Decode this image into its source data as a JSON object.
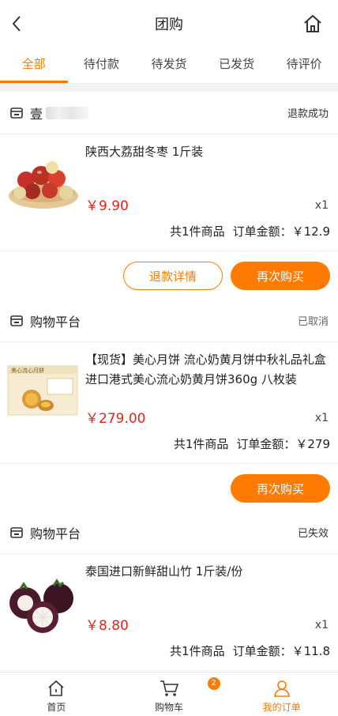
{
  "header": {
    "title": "团购",
    "back_icon": "chevron-left-icon",
    "home_icon": "home-icon"
  },
  "tabs": [
    {
      "label": "全部",
      "active": true
    },
    {
      "label": "待付款",
      "active": false
    },
    {
      "label": "待发货",
      "active": false
    },
    {
      "label": "已发货",
      "active": false
    },
    {
      "label": "待评价",
      "active": false
    }
  ],
  "orders": [
    {
      "shop_name": "壹",
      "status": "退款成功",
      "product_name": "陕西大荔甜冬枣 1斤装",
      "price": "￥9.90",
      "quantity": "x1",
      "item_count": "共1件商品",
      "total": "订单金额：￥12.9",
      "buttons": [
        "退款详情",
        "再次购买"
      ]
    },
    {
      "shop_name": "购物平台",
      "status": "已取消",
      "product_name": "【现货】美心月饼 流心奶黄月饼中秋礼品礼盒 进口港式美心流心奶黄月饼360g 八枚装",
      "price": "￥279.00",
      "quantity": "x1",
      "item_count": "共1件商品",
      "total": "订单金额：￥279",
      "buttons": [
        "再次购买"
      ],
      "thumb_text": "美心流心月餅"
    },
    {
      "shop_name": "购物平台",
      "status": "已失效",
      "product_name": "泰国进口新鲜甜山竹 1斤装/份",
      "price": "￥8.80",
      "quantity": "x1",
      "item_count": "共1件商品",
      "total": "订单金额：￥11.8"
    }
  ],
  "bottom_nav": [
    {
      "label": "首页",
      "icon": "home-icon"
    },
    {
      "label": "购物车",
      "icon": "cart-icon",
      "badge": "2"
    },
    {
      "label": "我的订单",
      "icon": "user-icon",
      "active": true
    }
  ],
  "colors": {
    "accent": "#ff7a00",
    "price": "#e5231b",
    "background": "#f2f2f2"
  }
}
